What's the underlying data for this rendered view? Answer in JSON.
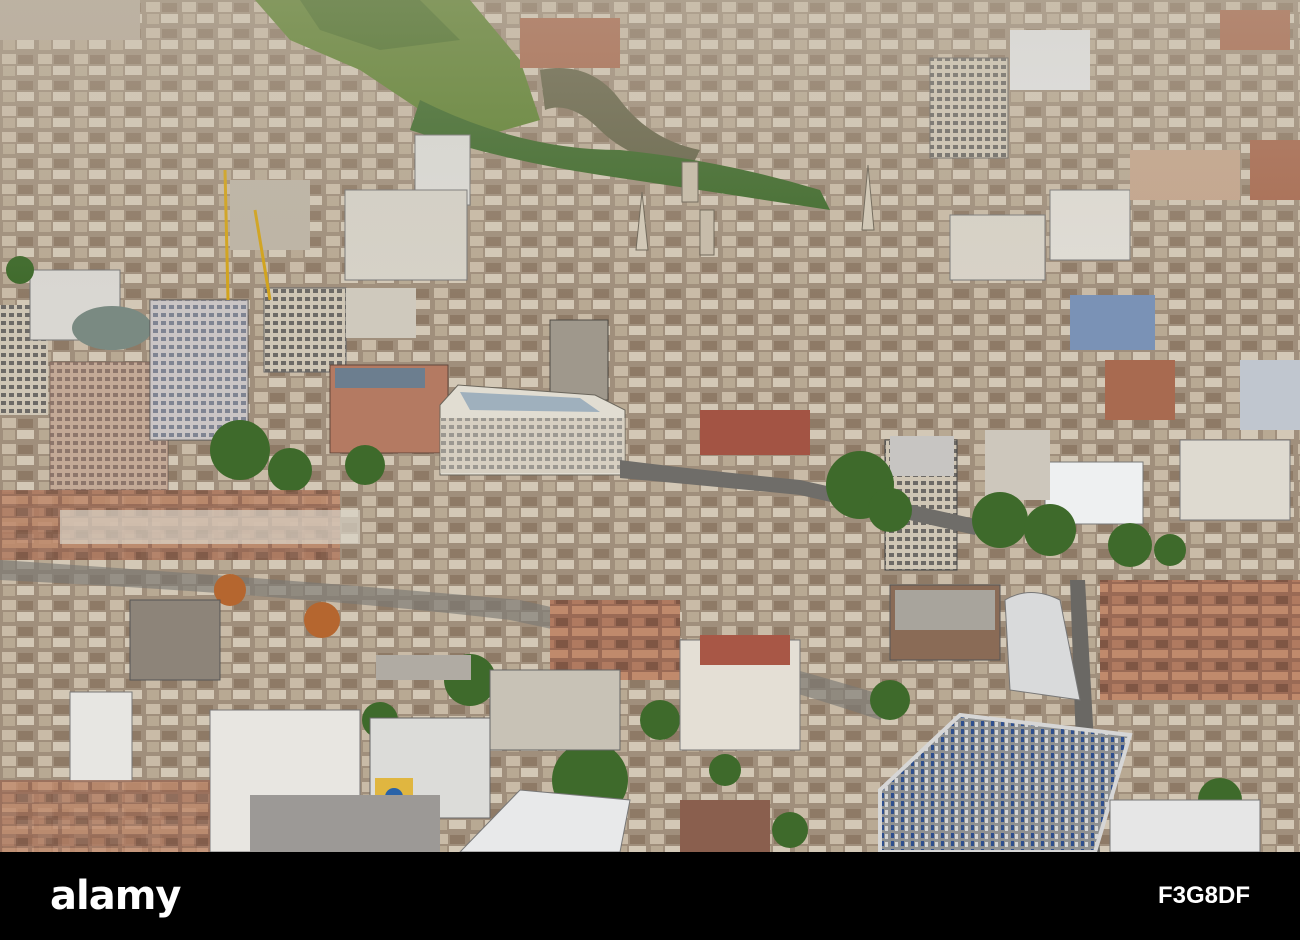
{
  "footer": {
    "brand": "alamy",
    "stock_id": "F3G8DF"
  },
  "colors": {
    "footer_background": "#000000",
    "footer_text": "#ffffff",
    "rooftop_light": "#d9d2c4",
    "rooftop_dark": "#7d6c5c",
    "brick": "#9b5c46",
    "tree": "#3e6a2b",
    "park": "#6f8f3c",
    "river": "#6b6a4e"
  },
  "photo": {
    "subject": "aerial-view-city-centre"
  }
}
